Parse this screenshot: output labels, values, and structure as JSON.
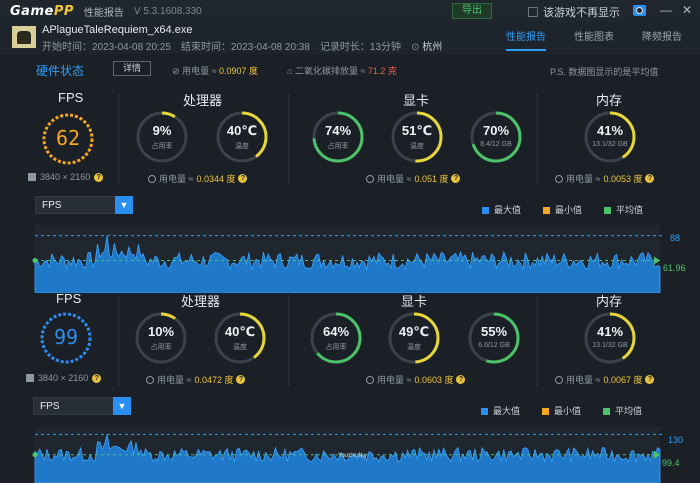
{
  "titlebar": {
    "logo": "GamePP",
    "report_label": "性能报告",
    "version": "V 5.3.1608.330",
    "export_label": "导出",
    "no_hint_label": "该游戏不再显示",
    "camera_icon": "camera-icon",
    "minimize_glyph": "—",
    "close_glyph": "✕"
  },
  "game": {
    "name": "APlagueTaleRequiem_x64.exe",
    "start": "开始时间：2023-04-08 20:25",
    "end": "结束时间：2023-04-08 20:38",
    "duration": "记录时长：13分钟",
    "location": "杭州"
  },
  "tabs": [
    {
      "label": "性能报告",
      "active": true
    },
    {
      "label": "性能图表",
      "active": false
    },
    {
      "label": "降频报告",
      "active": false
    }
  ],
  "hardware": {
    "title": "硬件状态",
    "detail_label": "详情",
    "power_prefix": "用电量 ≈ ",
    "power_value": "0.0907 度",
    "co2_prefix": "二氧化碳排放量 ≈ ",
    "co2_value": "71.2 克",
    "ps_note": "P.S. 数据图显示的是平均值"
  },
  "colors": {
    "accent": "#2f9cf5",
    "yellow": "#f0c53a",
    "green": "#4cc26a",
    "fps_orange": "#f5a623",
    "fps_blue": "#2a8ff0"
  },
  "panels": [
    {
      "fps": {
        "title": "FPS",
        "value": "62",
        "resolution": "3840 × 2160",
        "color": "#f5a623",
        "fraction": 1
      },
      "cpu": {
        "title": "处理器",
        "usage": "9%",
        "usage_label": "占用率",
        "usage_fraction": 0.09,
        "temp": "40℃",
        "temp_label": "温度",
        "temp_fraction": 0.4,
        "power_prefix": "用电量 ≈ ",
        "power_value": "0.0344 度"
      },
      "gpu": {
        "title": "显卡",
        "usage": "74%",
        "usage_label": "占用率",
        "usage_fraction": 0.74,
        "temp": "51℃",
        "temp_label": "温度",
        "temp_fraction": 0.51,
        "vram": "70%",
        "vram_sub": "8.4/12 GB",
        "vram_fraction": 0.7,
        "power_prefix": "用电量 ≈ ",
        "power_value": "0.051 度"
      },
      "mem": {
        "title": "内存",
        "value": "41%",
        "sub": "13.1/32 GB",
        "fraction": 0.41,
        "power_prefix": "用电量 ≈ ",
        "power_value": "0.0053 度"
      },
      "chart": {
        "select_label": "FPS",
        "legend_max": "最大值",
        "legend_min": "最小值",
        "legend_avg": "平均值",
        "max_label": "88",
        "avg_label": "61.96"
      }
    },
    {
      "fps": {
        "title": "FPS",
        "value": "99",
        "resolution": "3840 × 2160",
        "color": "#2a8ff0",
        "fraction": 1
      },
      "cpu": {
        "title": "处理器",
        "usage": "10%",
        "usage_label": "占用率",
        "usage_fraction": 0.1,
        "temp": "40℃",
        "temp_label": "温度",
        "temp_fraction": 0.4,
        "power_prefix": "用电量 ≈ ",
        "power_value": "0.0472 度"
      },
      "gpu": {
        "title": "显卡",
        "usage": "64%",
        "usage_label": "占用率",
        "usage_fraction": 0.64,
        "temp": "49℃",
        "temp_label": "温度",
        "temp_fraction": 0.49,
        "vram": "55%",
        "vram_sub": "6.6/12 GB",
        "vram_fraction": 0.55,
        "power_prefix": "用电量 ≈ ",
        "power_value": "0.0603 度"
      },
      "mem": {
        "title": "内存",
        "value": "41%",
        "sub": "13.1/32 GB",
        "fraction": 0.41,
        "power_prefix": "用电量 ≈ ",
        "power_value": "0.0067 度"
      },
      "chart": {
        "select_label": "FPS",
        "legend_max": "最大值",
        "legend_min": "最小值",
        "legend_avg": "平均值",
        "max_label": "130",
        "avg_label": "99.4",
        "watermark": "Youzhusky"
      }
    }
  ],
  "chart_data": [
    {
      "type": "area",
      "series": [
        {
          "name": "FPS",
          "max": 88,
          "avg": 61.96
        }
      ],
      "ylim": [
        30,
        95
      ]
    },
    {
      "type": "area",
      "series": [
        {
          "name": "FPS",
          "max": 130,
          "avg": 99.4
        }
      ],
      "ylim": [
        60,
        135
      ]
    }
  ]
}
